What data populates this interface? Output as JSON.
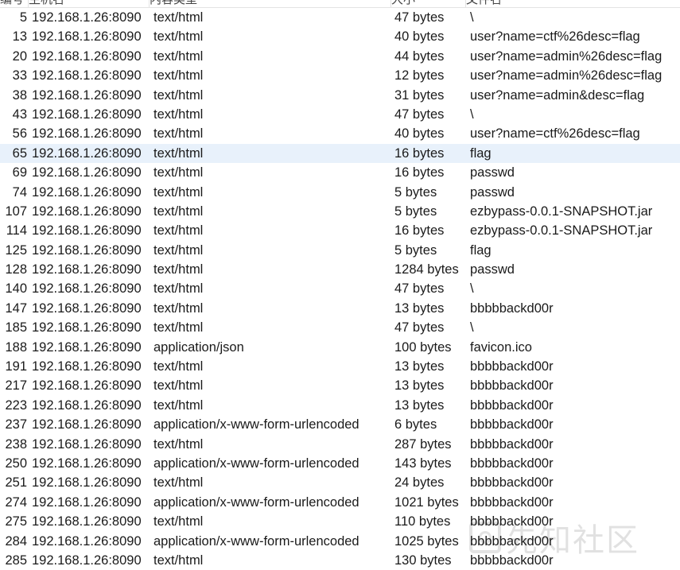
{
  "header": {
    "columns": [
      "编号",
      "主机名",
      "内容类型",
      "大小",
      "文件名"
    ]
  },
  "rows": [
    {
      "num": "5",
      "host": "192.168.1.26:8090",
      "type": "text/html",
      "size": "47 bytes",
      "file": "\\"
    },
    {
      "num": "13",
      "host": "192.168.1.26:8090",
      "type": "text/html",
      "size": "40 bytes",
      "file": "user?name=ctf%26desc=flag"
    },
    {
      "num": "20",
      "host": "192.168.1.26:8090",
      "type": "text/html",
      "size": "44 bytes",
      "file": "user?name=admin%26desc=flag"
    },
    {
      "num": "33",
      "host": "192.168.1.26:8090",
      "type": "text/html",
      "size": "12 bytes",
      "file": "user?name=admin%26desc=flag"
    },
    {
      "num": "38",
      "host": "192.168.1.26:8090",
      "type": "text/html",
      "size": "31 bytes",
      "file": "user?name=admin&desc=flag"
    },
    {
      "num": "43",
      "host": "192.168.1.26:8090",
      "type": "text/html",
      "size": "47 bytes",
      "file": "\\"
    },
    {
      "num": "56",
      "host": "192.168.1.26:8090",
      "type": "text/html",
      "size": "40 bytes",
      "file": "user?name=ctf%26desc=flag"
    },
    {
      "num": "65",
      "host": "192.168.1.26:8090",
      "type": "text/html",
      "size": "16 bytes",
      "file": "flag",
      "selected": true
    },
    {
      "num": "69",
      "host": "192.168.1.26:8090",
      "type": "text/html",
      "size": "16 bytes",
      "file": "passwd"
    },
    {
      "num": "74",
      "host": "192.168.1.26:8090",
      "type": "text/html",
      "size": "5 bytes",
      "file": "passwd"
    },
    {
      "num": "107",
      "host": "192.168.1.26:8090",
      "type": "text/html",
      "size": "5 bytes",
      "file": "ezbypass-0.0.1-SNAPSHOT.jar"
    },
    {
      "num": "114",
      "host": "192.168.1.26:8090",
      "type": "text/html",
      "size": "16 bytes",
      "file": "ezbypass-0.0.1-SNAPSHOT.jar"
    },
    {
      "num": "125",
      "host": "192.168.1.26:8090",
      "type": "text/html",
      "size": "5 bytes",
      "file": "flag"
    },
    {
      "num": "128",
      "host": "192.168.1.26:8090",
      "type": "text/html",
      "size": "1284 bytes",
      "file": "passwd"
    },
    {
      "num": "140",
      "host": "192.168.1.26:8090",
      "type": "text/html",
      "size": "47 bytes",
      "file": "\\"
    },
    {
      "num": "147",
      "host": "192.168.1.26:8090",
      "type": "text/html",
      "size": "13 bytes",
      "file": "bbbbbackd00r"
    },
    {
      "num": "185",
      "host": "192.168.1.26:8090",
      "type": "text/html",
      "size": "47 bytes",
      "file": "\\"
    },
    {
      "num": "188",
      "host": "192.168.1.26:8090",
      "type": "application/json",
      "size": "100 bytes",
      "file": "favicon.ico"
    },
    {
      "num": "191",
      "host": "192.168.1.26:8090",
      "type": "text/html",
      "size": "13 bytes",
      "file": "bbbbbackd00r"
    },
    {
      "num": "217",
      "host": "192.168.1.26:8090",
      "type": "text/html",
      "size": "13 bytes",
      "file": "bbbbbackd00r"
    },
    {
      "num": "223",
      "host": "192.168.1.26:8090",
      "type": "text/html",
      "size": "13 bytes",
      "file": "bbbbbackd00r"
    },
    {
      "num": "237",
      "host": "192.168.1.26:8090",
      "type": "application/x-www-form-urlencoded",
      "size": "6 bytes",
      "file": "bbbbbackd00r"
    },
    {
      "num": "238",
      "host": "192.168.1.26:8090",
      "type": "text/html",
      "size": "287 bytes",
      "file": "bbbbbackd00r"
    },
    {
      "num": "250",
      "host": "192.168.1.26:8090",
      "type": "application/x-www-form-urlencoded",
      "size": "143 bytes",
      "file": "bbbbbackd00r"
    },
    {
      "num": "251",
      "host": "192.168.1.26:8090",
      "type": "text/html",
      "size": "24 bytes",
      "file": "bbbbbackd00r"
    },
    {
      "num": "274",
      "host": "192.168.1.26:8090",
      "type": "application/x-www-form-urlencoded",
      "size": "1021 bytes",
      "file": "bbbbbackd00r"
    },
    {
      "num": "275",
      "host": "192.168.1.26:8090",
      "type": "text/html",
      "size": "110 bytes",
      "file": "bbbbbackd00r"
    },
    {
      "num": "284",
      "host": "192.168.1.26:8090",
      "type": "application/x-www-form-urlencoded",
      "size": "1025 bytes",
      "file": "bbbbbackd00r"
    },
    {
      "num": "285",
      "host": "192.168.1.26:8090",
      "type": "text/html",
      "size": "130 bytes",
      "file": "bbbbbackd00r"
    }
  ],
  "watermark": {
    "text": "先知社区",
    "icon": "xianzhi-logo-icon"
  }
}
